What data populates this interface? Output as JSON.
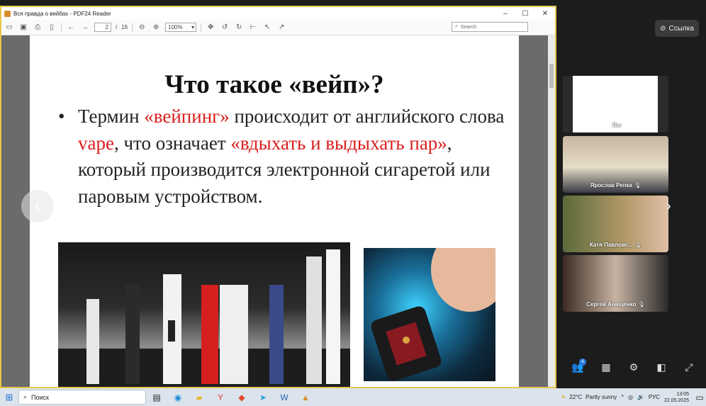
{
  "window": {
    "title": "Вся правда о вейбах - PDF24 Reader",
    "min": "–",
    "max": "☐",
    "close": "✕"
  },
  "toolbar": {
    "page_current": "2",
    "page_sep": "/",
    "page_total": "16",
    "zoom": "100%",
    "search_placeholder": "Search"
  },
  "slide": {
    "title": "Что такое «вейп»?",
    "bullet": "•",
    "text_1": "Термин ",
    "text_2": "«вейпинг»",
    "text_3": " происходит от английского слова ",
    "text_4": "vape",
    "text_5": ", что означает ",
    "text_6": "«вдыхать и выдыхать пар»",
    "text_7": ", который производится электронной сигаретой или паровым устройством."
  },
  "meeting": {
    "link_label": "Ссылка",
    "participants": [
      {
        "name": "Вы"
      },
      {
        "name": "Ярослав Репка"
      },
      {
        "name": "Катя Павловс..."
      },
      {
        "name": "Сергей Анищенко"
      }
    ],
    "participants_count": "4"
  },
  "taskbar": {
    "search_label": "Поиск",
    "temperature": "22°C",
    "weather": "Partly sunny",
    "lang": "РУС",
    "time": "13:05",
    "date": "22.05.2025"
  },
  "colors": {
    "accent_red": "#d8201e",
    "window_border": "#e6c84a"
  }
}
